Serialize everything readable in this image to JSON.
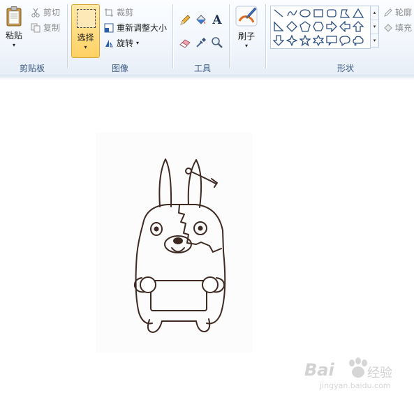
{
  "ribbon": {
    "clipboard": {
      "group_label": "剪贴板",
      "paste_label": "粘贴",
      "paste_arrow": "▾",
      "cut_label": "剪切",
      "copy_label": "复制"
    },
    "image": {
      "group_label": "图像",
      "select_label": "选择",
      "select_arrow": "▾",
      "crop_label": "裁剪",
      "resize_label": "重新调整大小",
      "rotate_label": "旋转",
      "rotate_arrow": "▾"
    },
    "tools": {
      "group_label": "工具",
      "text_tool_glyph": "A"
    },
    "brushes": {
      "label": "刷子",
      "arrow": "▾"
    },
    "shapes": {
      "group_label": "形状",
      "outline_label": "轮廓",
      "fill_label": "填充",
      "scroll_up": "▴",
      "scroll_down": "▾",
      "scroll_more": "▾"
    },
    "colors": {
      "accent_selected": "#ffd163",
      "group_label_color": "#3b5a82"
    }
  },
  "watermark": {
    "brand_text": "Bai",
    "brand_suffix": "经验",
    "url": "jingyan.baidu.com"
  }
}
